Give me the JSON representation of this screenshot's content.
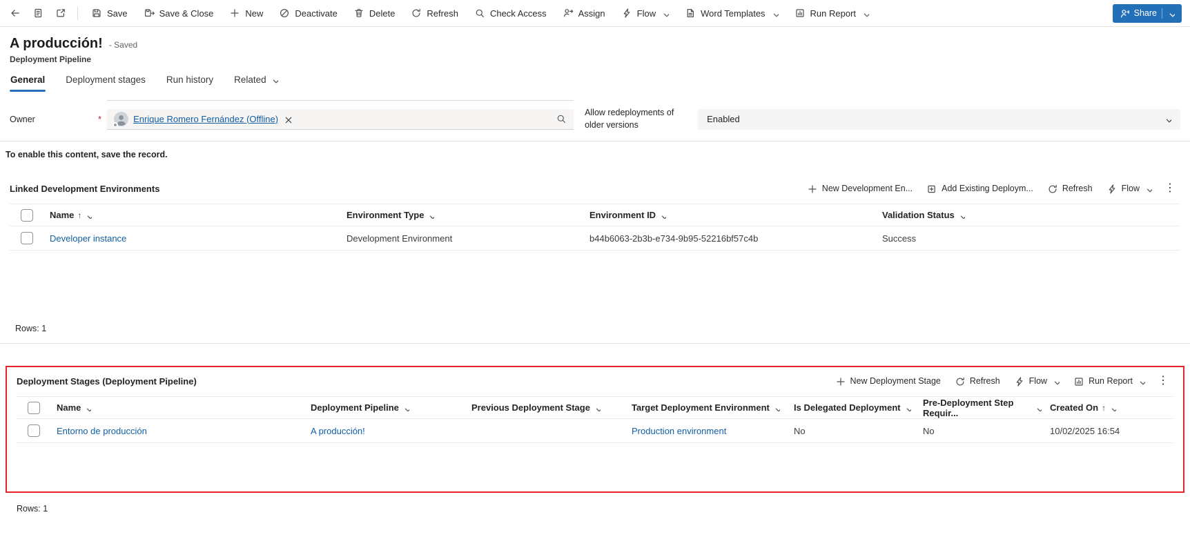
{
  "colors": {
    "accent": "#2470b8",
    "annotation_highlight": "#e8242a",
    "link": "#115ea3"
  },
  "command_bar": {
    "save": "Save",
    "save_close": "Save & Close",
    "new": "New",
    "deactivate": "Deactivate",
    "delete": "Delete",
    "refresh": "Refresh",
    "check_access": "Check Access",
    "assign": "Assign",
    "flow": "Flow",
    "word_templates": "Word Templates",
    "run_report": "Run Report",
    "share": "Share"
  },
  "header": {
    "title": "A producción!",
    "saved": "- Saved",
    "entity": "Deployment Pipeline"
  },
  "tabs": {
    "general": "General",
    "deployment_stages": "Deployment stages",
    "run_history": "Run history",
    "related": "Related"
  },
  "form": {
    "owner_label": "Owner",
    "owner_value": "Enrique Romero Fernández (Offline)",
    "redeploy_label": "Allow redeployments of older versions",
    "redeploy_value": "Enabled",
    "notice": "To enable this content, save the record."
  },
  "linked_environments": {
    "title": "Linked Development Environments",
    "commands": {
      "new": "New Development En...",
      "add_existing": "Add Existing Deploym...",
      "refresh": "Refresh",
      "flow": "Flow"
    },
    "columns": {
      "name": "Name",
      "type": "Environment Type",
      "id": "Environment ID",
      "status": "Validation Status"
    },
    "row": {
      "name": "Developer instance",
      "type": "Development Environment",
      "id": "b44b6063-2b3b-e734-9b95-52216bf57c4b",
      "status": "Success"
    },
    "rows_label": "Rows: 1"
  },
  "deployment_stages": {
    "title": "Deployment Stages (Deployment Pipeline)",
    "commands": {
      "new": "New Deployment Stage",
      "refresh": "Refresh",
      "flow": "Flow",
      "run_report": "Run Report"
    },
    "columns": {
      "name": "Name",
      "pipeline": "Deployment Pipeline",
      "previous": "Previous Deployment Stage",
      "target": "Target Deployment Environment",
      "delegated": "Is Delegated Deployment",
      "predeploy": "Pre-Deployment Step Requir...",
      "created": "Created On"
    },
    "row": {
      "name": "Entorno de producción",
      "pipeline": "A producción!",
      "previous": "",
      "target": "Production environment",
      "delegated": "No",
      "predeploy": "No",
      "created": "10/02/2025 16:54"
    },
    "rows_label": "Rows: 1"
  }
}
